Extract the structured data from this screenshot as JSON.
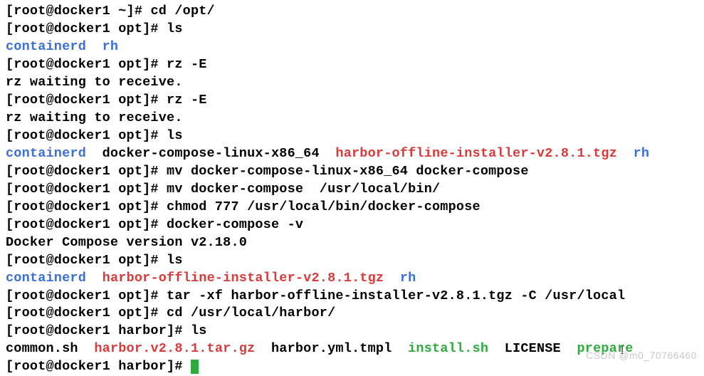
{
  "lines": {
    "l1_prompt": "[root@docker1 ~]# ",
    "l1_cmd": "cd /opt/",
    "l2_prompt": "[root@docker1 opt]# ",
    "l2_cmd": "ls",
    "l3_a": "containerd",
    "l3_b": "  rh",
    "l4_prompt": "[root@docker1 opt]# ",
    "l4_cmd": "rz -E",
    "l5": "rz waiting to receive.",
    "l6_prompt": "[root@docker1 opt]# ",
    "l6_cmd": "rz -E",
    "l7": "rz waiting to receive.",
    "l8_prompt": "[root@docker1 opt]# ",
    "l8_cmd": "ls",
    "l9_a": "containerd",
    "l9_b": "  docker-compose-linux-x86_64  ",
    "l9_c": "harbor-offline-installer-v2.8.1.tgz",
    "l9_d": "  rh",
    "l10_prompt": "[root@docker1 opt]# ",
    "l10_cmd": "mv docker-compose-linux-x86_64 docker-compose",
    "l11_prompt": "[root@docker1 opt]# ",
    "l11_cmd": "mv docker-compose  /usr/local/bin/",
    "l12_prompt": "[root@docker1 opt]# ",
    "l12_cmd": "chmod 777 /usr/local/bin/docker-compose",
    "l13_prompt": "[root@docker1 opt]# ",
    "l13_cmd": "docker-compose -v",
    "l14": "Docker Compose version v2.18.0",
    "l15_prompt": "[root@docker1 opt]# ",
    "l15_cmd": "ls",
    "l16_a": "containerd",
    "l16_b": "  ",
    "l16_c": "harbor-offline-installer-v2.8.1.tgz",
    "l16_d": "  rh",
    "l17_prompt": "[root@docker1 opt]# ",
    "l17_cmd": "tar -xf harbor-offline-installer-v2.8.1.tgz -C /usr/local",
    "l18_prompt": "[root@docker1 opt]# ",
    "l18_cmd": "cd /usr/local/harbor/",
    "l19_prompt": "[root@docker1 harbor]# ",
    "l19_cmd": "ls",
    "l20_a": "common.sh  ",
    "l20_b": "harbor.v2.8.1.tar.gz",
    "l20_c": "  harbor.yml.tmpl  ",
    "l20_d": "install.sh",
    "l20_e": "  LICENSE  ",
    "l20_f": "prepare",
    "l21_prompt": "[root@docker1 harbor]# "
  },
  "watermark": "CSDN @m0_70766460"
}
